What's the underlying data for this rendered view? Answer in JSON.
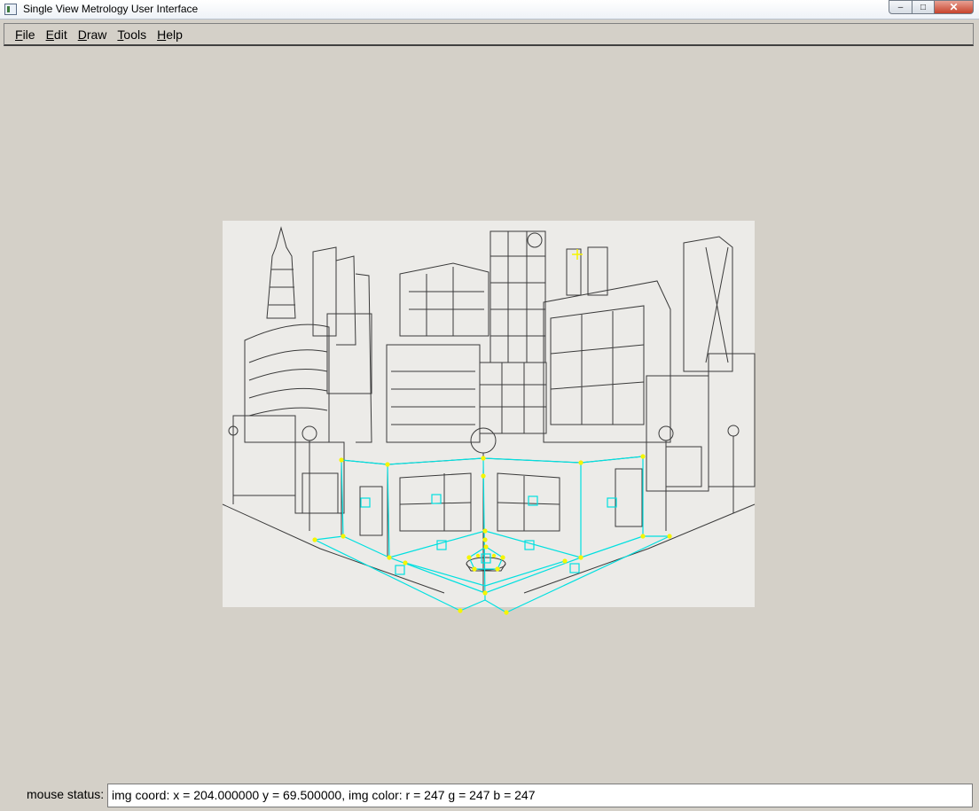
{
  "window": {
    "title": "Single View Metrology User Interface",
    "controls": {
      "minimize": "–",
      "maximize": "□",
      "close": "✕"
    }
  },
  "menubar": {
    "items": [
      {
        "label": "File",
        "mnemonic": "F",
        "rest": "ile"
      },
      {
        "label": "Edit",
        "mnemonic": "E",
        "rest": "dit"
      },
      {
        "label": "Draw",
        "mnemonic": "D",
        "rest": "raw"
      },
      {
        "label": "Tools",
        "mnemonic": "T",
        "rest": "ools"
      },
      {
        "label": "Help",
        "mnemonic": "H",
        "rest": "elp"
      }
    ]
  },
  "image": {
    "description_icon": "city-sketch-image",
    "overlay_color": "#00e5e5",
    "marker_color": "#f5f500"
  },
  "status": {
    "label": "mouse status:",
    "value": "img coord: x = 204.000000 y = 69.500000, img color: r = 247 g = 247 b = 247"
  }
}
